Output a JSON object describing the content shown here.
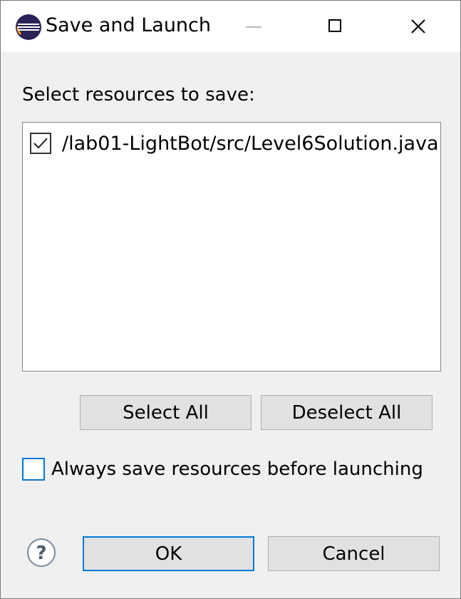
{
  "window": {
    "title": "Save and Launch",
    "app_icon": "eclipse-icon",
    "controls": [
      "minimize-icon",
      "maximize-icon",
      "close-icon"
    ]
  },
  "dialog": {
    "prompt": "Select resources to save:",
    "resources": [
      {
        "path": "/lab01-LightBot/src/Level6Solution.java",
        "checked": true
      }
    ],
    "select_all_label": "Select All",
    "deselect_all_label": "Deselect All",
    "always_save_label": "Always save resources before launching",
    "always_save_checked": false,
    "help_icon": "help-icon",
    "ok_label": "OK",
    "cancel_label": "Cancel"
  },
  "colors": {
    "accent": "#0078d7",
    "button_bg": "#e1e1e1",
    "dialog_bg": "#f0f0f0"
  }
}
